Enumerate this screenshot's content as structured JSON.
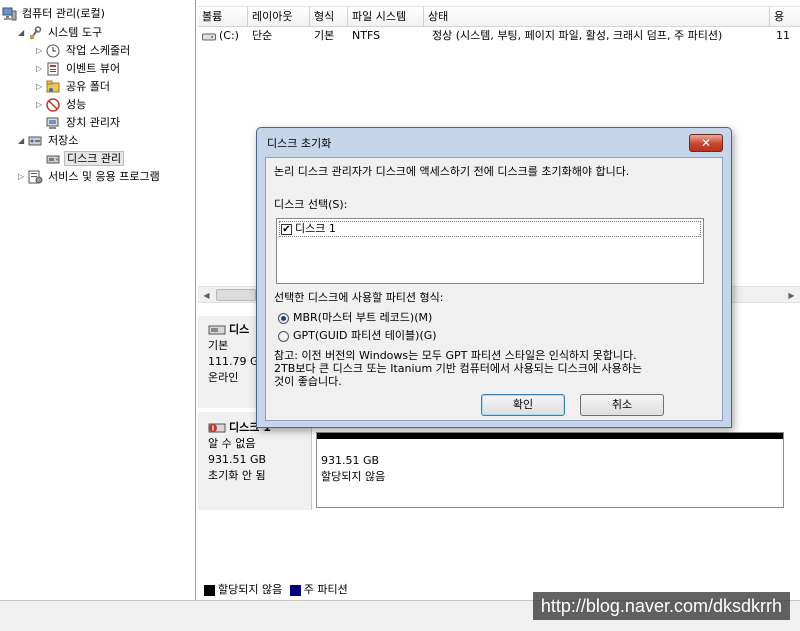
{
  "tree": {
    "root": "컴퓨터 관리(로컬)",
    "system_tools": "시스템 도구",
    "task_scheduler": "작업 스케줄러",
    "event_viewer": "이벤트 뷰어",
    "shared_folders": "공유 폴더",
    "performance": "성능",
    "device_manager": "장치 관리자",
    "storage": "저장소",
    "disk_management": "디스크 관리",
    "services_apps": "서비스 및 응용 프로그램"
  },
  "volume_list": {
    "headers": [
      "볼륨",
      "레이아웃",
      "형식",
      "파일 시스템",
      "상태",
      "용"
    ],
    "row": {
      "volume": "(C:)",
      "layout": "단순",
      "type": "기본",
      "fs": "NTFS",
      "status": "정상 (시스템, 부팅, 페이지 파일, 활성, 크래시 덤프, 주 파티션)",
      "capacity": "11"
    }
  },
  "disk0": {
    "name": "디스",
    "type": "기본",
    "size": "111.79 G",
    "state": "온라인"
  },
  "disk1": {
    "name": "디스크 1",
    "type": "알 수 없음",
    "size": "931.51 GB",
    "state": "초기화 안 됨",
    "partition_size": "931.51 GB",
    "partition_state": "할당되지 않음"
  },
  "legend": {
    "unallocated": "할당되지 않음",
    "primary": "주 파티션",
    "colors": {
      "unallocated": "#000000",
      "primary": "#00007f"
    }
  },
  "dialog": {
    "title": "디스크 초기화",
    "message": "논리 디스크 관리자가 디스크에 액세스하기 전에 디스크를 초기화해야 합니다.",
    "select_label": "디스크 선택(S):",
    "disk_item": "디스크 1",
    "disk_checked": true,
    "partition_label": "선택한 디스크에 사용할 파티션 형식:",
    "option_mbr": "MBR(마스터 부트 레코드)(M)",
    "option_gpt": "GPT(GUID 파티션 테이블)(G)",
    "note_line1": "참고: 이전 버전의 Windows는 모두 GPT 파티션 스타일은 인식하지 못합니다.",
    "note_line2": "2TB보다 큰 디스크 또는 Itanium 기반 컴퓨터에서 사용되는 디스크에 사용하는",
    "note_line3": "것이 좋습니다.",
    "ok": "확인",
    "cancel": "취소"
  },
  "watermark": "http://blog.naver.com/dksdkrrh"
}
